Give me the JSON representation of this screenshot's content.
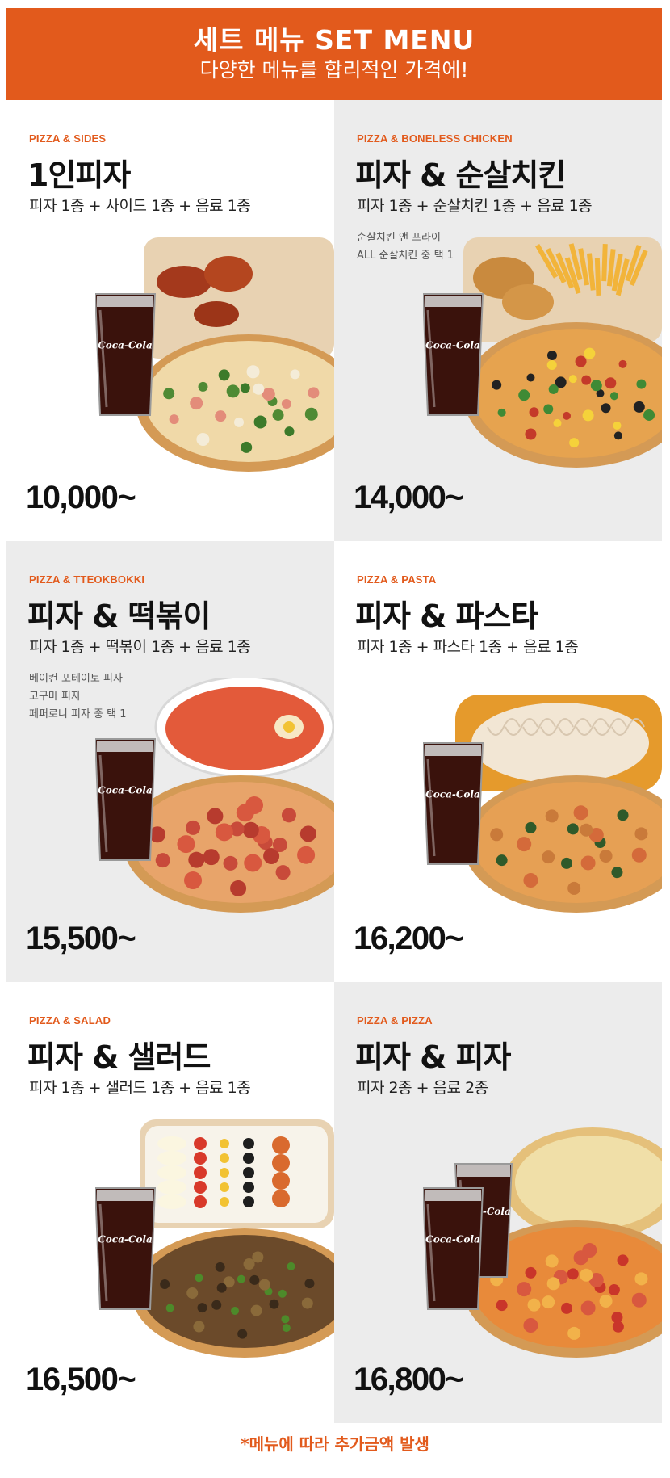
{
  "banner": {
    "title": "세트 메뉴 SET MENU",
    "subtitle": "다양한 메뉴를 합리적인 가격에!"
  },
  "cards": [
    {
      "category": "PIZZA & SIDES",
      "name": "1인피자",
      "composition": "피자 1종 + 사이드 1종 + 음료 1종",
      "note_lines": [],
      "price": "10,000~",
      "side": "wings"
    },
    {
      "category": "PIZZA & BONELESS CHICKEN",
      "name": "피자 & 순살치킨",
      "composition": "피자 1종 + 순살치킨 1종 + 음료 1종",
      "note_lines": [
        "순살치킨 앤 프라이",
        "ALL 순살치킨 중 택 1"
      ],
      "price": "14,000~",
      "side": "fries"
    },
    {
      "category": "PIZZA & TTEOKBOKKI",
      "name": "피자 & 떡볶이",
      "composition": "피자 1종 + 떡볶이 1종 + 음료 1종",
      "note_lines": [
        "베이컨 포테이토 피자",
        "고구마 피자",
        "페퍼로니 피자 중 택 1"
      ],
      "price": "15,500~",
      "side": "tteokbokki"
    },
    {
      "category": "PIZZA & PASTA",
      "name": "피자 & 파스타",
      "composition": "피자 1종 + 파스타 1종 + 음료 1종",
      "note_lines": [],
      "price": "16,200~",
      "side": "pasta"
    },
    {
      "category": "PIZZA & SALAD",
      "name": "피자 & 샐러드",
      "composition": "피자 1종 + 샐러드 1종 + 음료 1종",
      "note_lines": [],
      "price": "16,500~",
      "side": "salad"
    },
    {
      "category": "PIZZA & PIZZA",
      "name": "피자 & 피자",
      "composition": "피자 2종 + 음료 2종",
      "note_lines": [],
      "price": "16,800~",
      "side": "pizza2"
    }
  ],
  "cola_logo": "Coca-Cola",
  "footnote": "*메뉴에 따라 추가금액 발생",
  "colors": {
    "accent": "#e25a1c",
    "card_gray": "#ececec",
    "card_white": "#ffffff"
  }
}
